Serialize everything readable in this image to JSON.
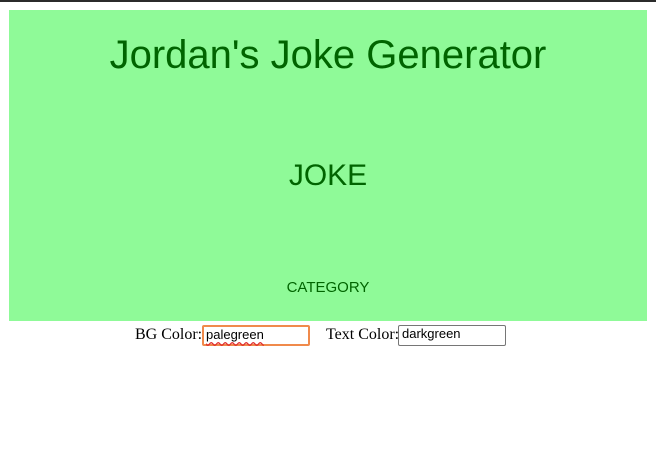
{
  "header": {
    "title": "Jordan's Joke Generator"
  },
  "joke": {
    "text": "JOKE",
    "category": "CATEGORY"
  },
  "controls": {
    "bg_color_label": "BG Color:",
    "bg_color_value": "palegreen",
    "text_color_label": "Text Color:",
    "text_color_value": "darkgreen"
  },
  "colors": {
    "panel_background": "#8ffa98",
    "panel_text": "#006400",
    "focus_border": "#f08a4b"
  }
}
